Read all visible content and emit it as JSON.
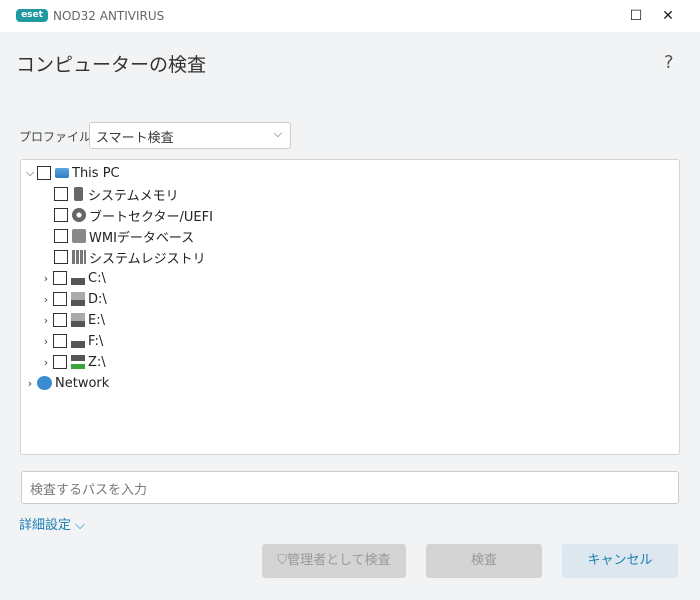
{
  "window": {
    "logo": "eset",
    "title": "NOD32 ANTIVIRUS",
    "minimize": "☐",
    "close": "✕"
  },
  "page": {
    "title": "コンピューターの検査",
    "help": "?"
  },
  "profile": {
    "label": "プロファイル",
    "value": "スマート検査"
  },
  "tree": {
    "root": "This PC",
    "items": [
      {
        "label": "システムメモリ",
        "icon": "memory-chip-icon"
      },
      {
        "label": "ブートセクター/UEFI",
        "icon": "disc-icon"
      },
      {
        "label": "WMIデータベース",
        "icon": "wmi-database-icon"
      },
      {
        "label": "システムレジストリ",
        "icon": "registry-icon"
      }
    ],
    "drives": [
      {
        "label": "C:\\",
        "icon": "system-drive-icon"
      },
      {
        "label": "D:\\",
        "icon": "optical-drive-icon"
      },
      {
        "label": "E:\\",
        "icon": "optical-drive-icon"
      },
      {
        "label": "F:\\",
        "icon": "drive-icon"
      },
      {
        "label": "Z:\\",
        "icon": "network-drive-icon"
      }
    ],
    "network": "Network"
  },
  "path_input": {
    "placeholder": "検査するパスを入力"
  },
  "advanced": "詳細設定",
  "buttons": {
    "admin_scan": "管理者として検査",
    "scan": "検査",
    "cancel": "キャンセル"
  },
  "colors": {
    "accent": "#1a7fb0",
    "brand": "#1e9aa0"
  }
}
